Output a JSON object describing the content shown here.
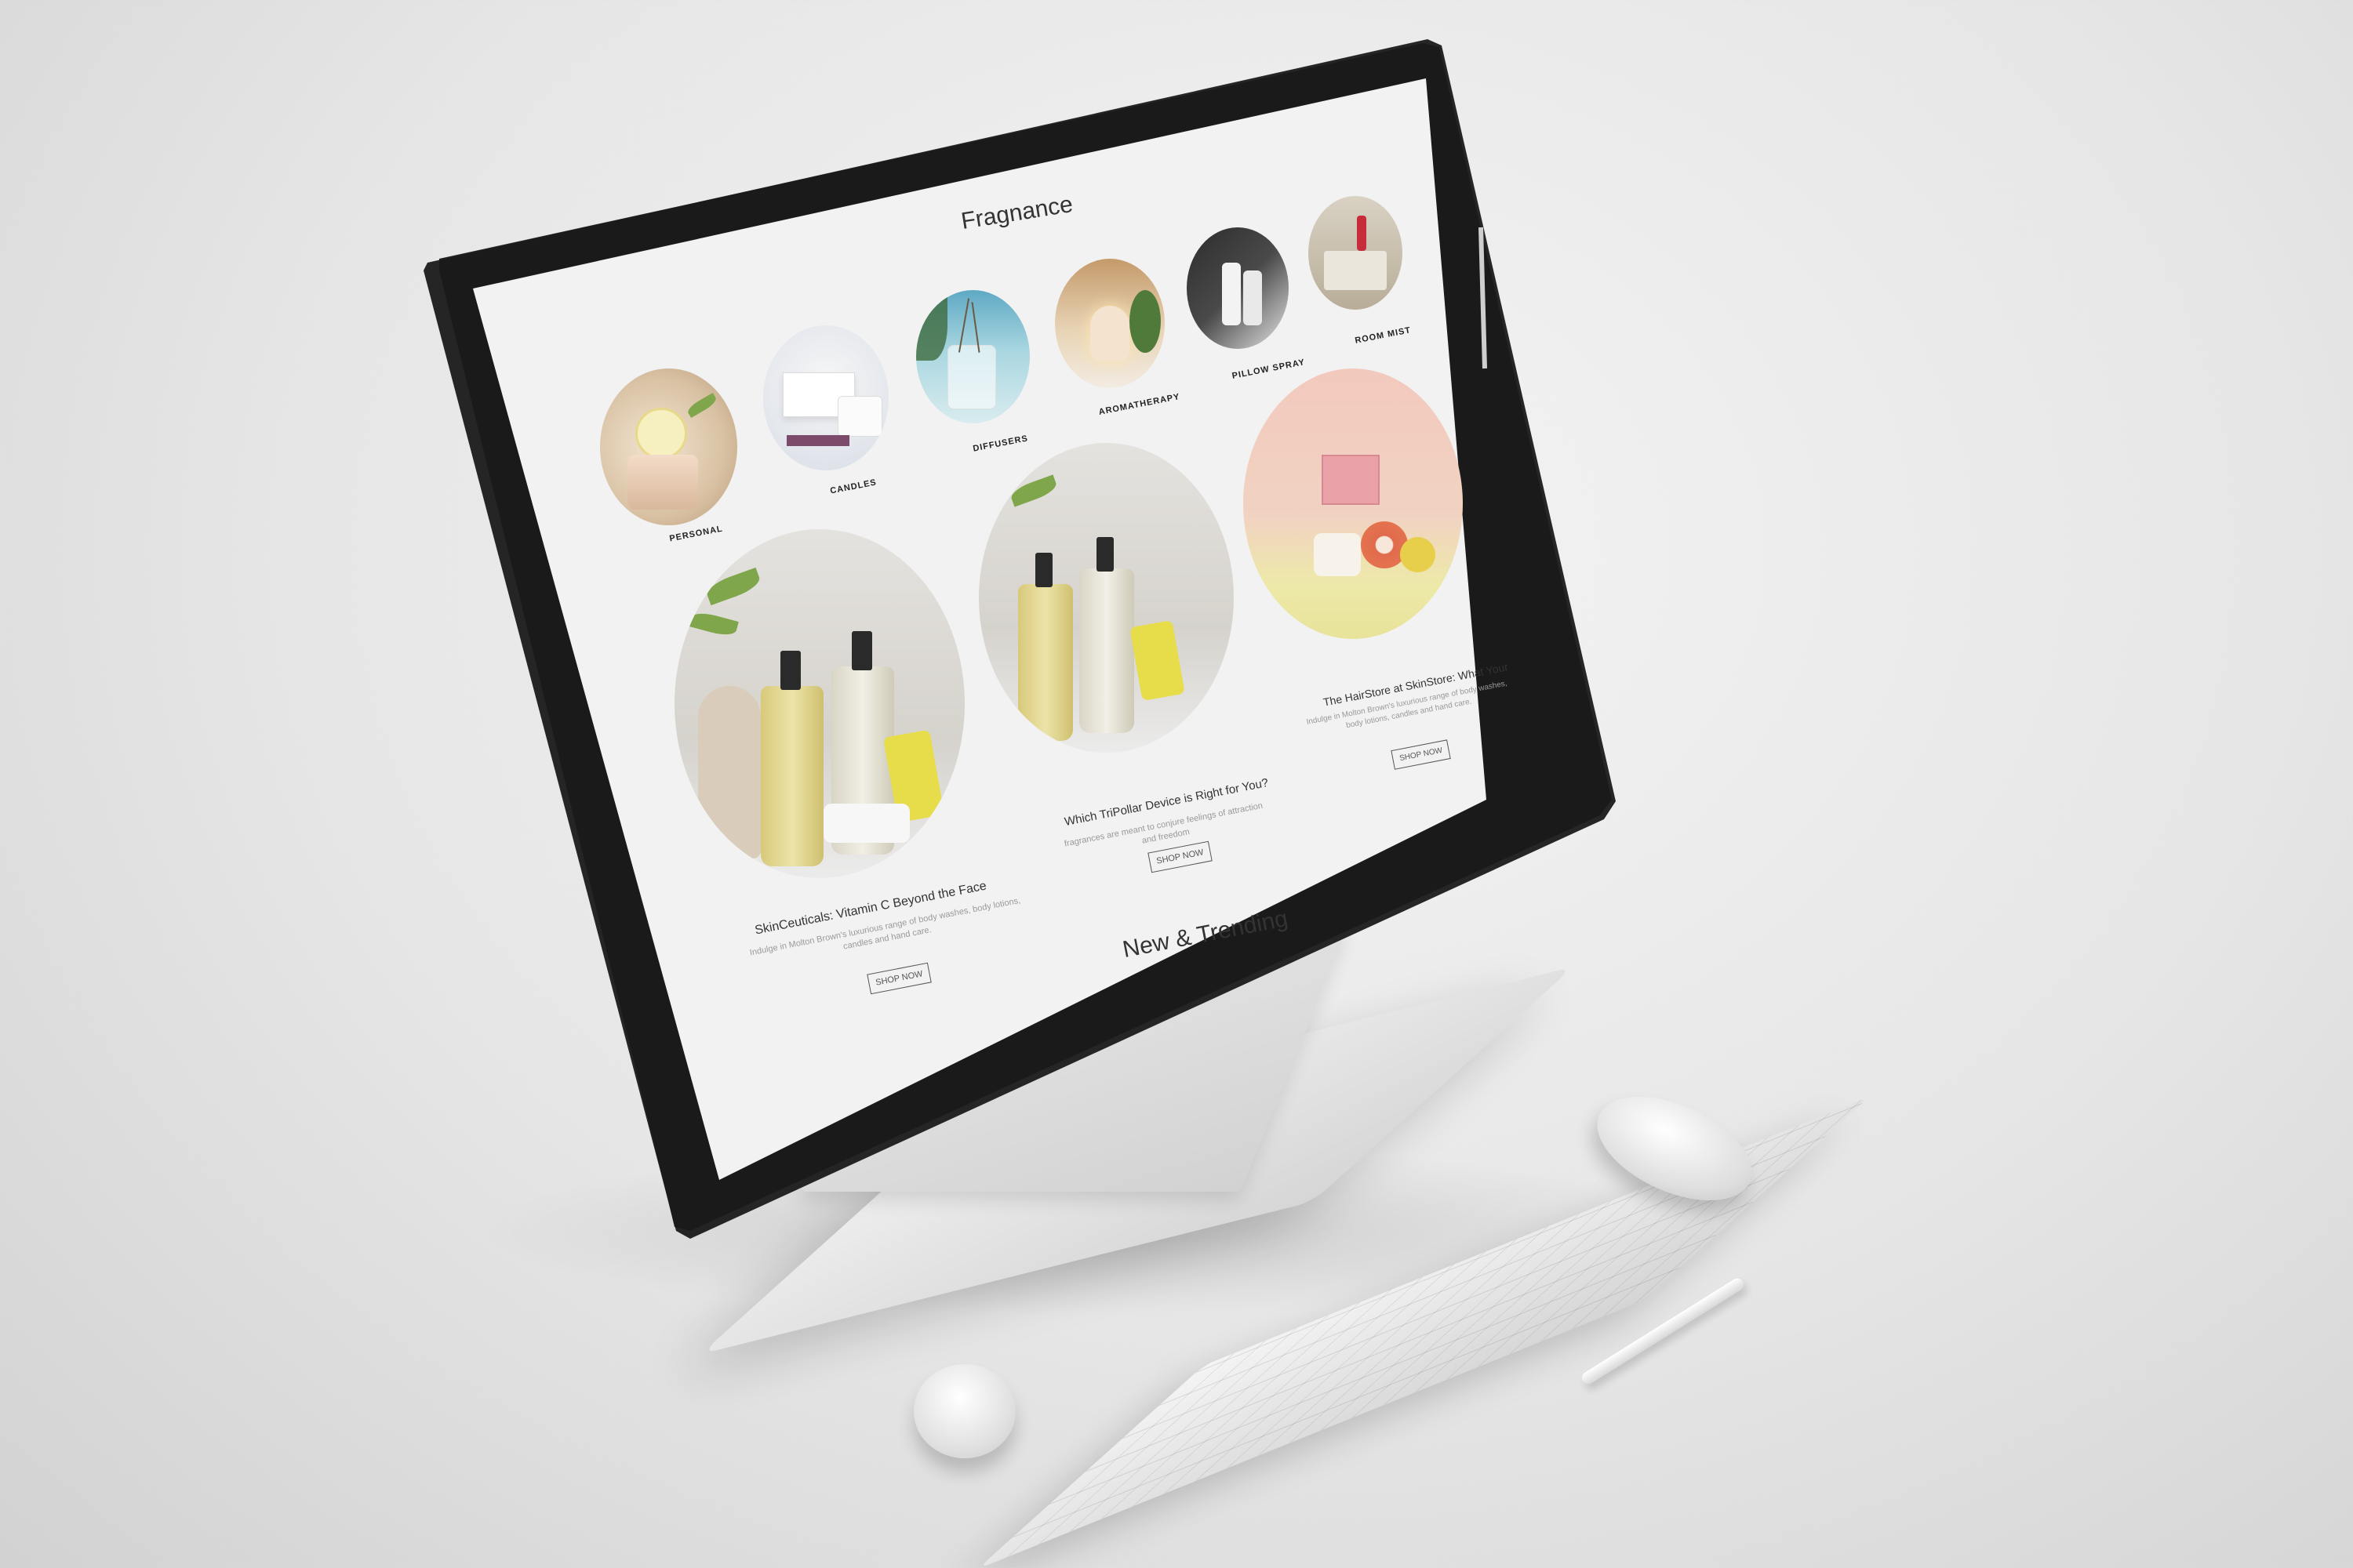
{
  "page": {
    "section_title": "Fragnance",
    "categories": [
      {
        "label": "PERSONAL"
      },
      {
        "label": "CANDLES"
      },
      {
        "label": "DIFFUSERS"
      },
      {
        "label": "AROMATHERAPY"
      },
      {
        "label": "PILLOW SPRAY"
      },
      {
        "label": "ROOM MIST"
      }
    ],
    "features": [
      {
        "title": "SkinCeuticals: Vitamin C Beyond the Face",
        "description": "Indulge in Molton Brown's luxurious range of body washes, body lotions, candles and hand care.",
        "button": "SHOP NOW"
      },
      {
        "title": "Which TriPollar Device is Right for You?",
        "description": "fragrances are meant to conjure feelings of attraction and freedom",
        "button": "SHOP NOW"
      },
      {
        "title": "The HairStore at SkinStore: What Your",
        "description": "Indulge in Molton Brown's luxurious range of body washes, body lotions, candles and hand care.",
        "button": "SHOP NOW"
      }
    ],
    "next_section_title": "New & Trending"
  },
  "colors": {
    "page_background": "#f2f2f2",
    "bezel": "#1a1a1a",
    "text_primary": "#333333",
    "text_muted": "#999999"
  }
}
